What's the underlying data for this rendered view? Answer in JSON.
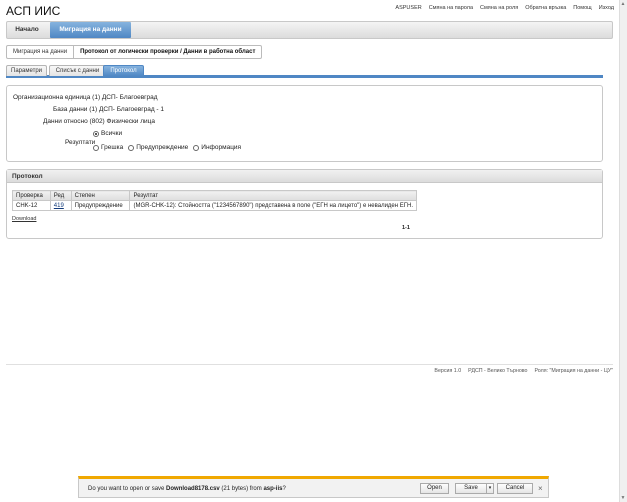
{
  "app": {
    "title": "АСП ИИС"
  },
  "top_links": [
    "ASPUSER",
    "Смяна на парола",
    "Смяна на роля",
    "Обратна връзка",
    "Помощ",
    "Изход"
  ],
  "nav": {
    "home": "Начало",
    "migration": "Миграция на данни"
  },
  "breadcrumb": {
    "first": "Миграция на данни",
    "current": "Протокол от логически проверки / Данни в работна област"
  },
  "tabs": {
    "params": "Параметри",
    "list": "Списък с данни",
    "protocol": "Протокол"
  },
  "params": {
    "org_unit": "Организационна единица (1) ДСП- Благоевград",
    "database": "База данни (1) ДСП- Благоевград - 1",
    "data_about": "Данни относно (802) Физически лица",
    "result_label": "Резултати",
    "options": {
      "all": "Всички",
      "error": "Грешка",
      "warning": "Предупреждение",
      "info": "Информация"
    }
  },
  "protocol": {
    "title": "Протокол",
    "columns": {
      "check": "Проверка",
      "row": "Ред",
      "level": "Степен",
      "result": "Резултат"
    },
    "rows": [
      {
        "check": "CHK-12",
        "row": "419",
        "level": "Предупреждение",
        "result": "(MGR-CHK-12): Стойността (\"1234567890\") представена в поле (\"ЕГН на лицето\") е невалиден ЕГН."
      }
    ],
    "download": "Download",
    "pager": "1-1"
  },
  "footer": {
    "version": "Версия 1.0",
    "office": "РДСП - Велико Търново",
    "role": "Роля: \"Миграция на данни - ЦУ\""
  },
  "download_bar": {
    "prefix": "Do you want to open or save ",
    "filename": "Download8178.csv",
    "size": " (21 bytes) from ",
    "host": "asp-iis",
    "suffix": "?",
    "open": "Open",
    "save": "Save",
    "save_arrow": "▾",
    "cancel": "Cancel",
    "close": "×"
  },
  "icons": {
    "scroll_up": "▲",
    "scroll_down": "▼"
  }
}
